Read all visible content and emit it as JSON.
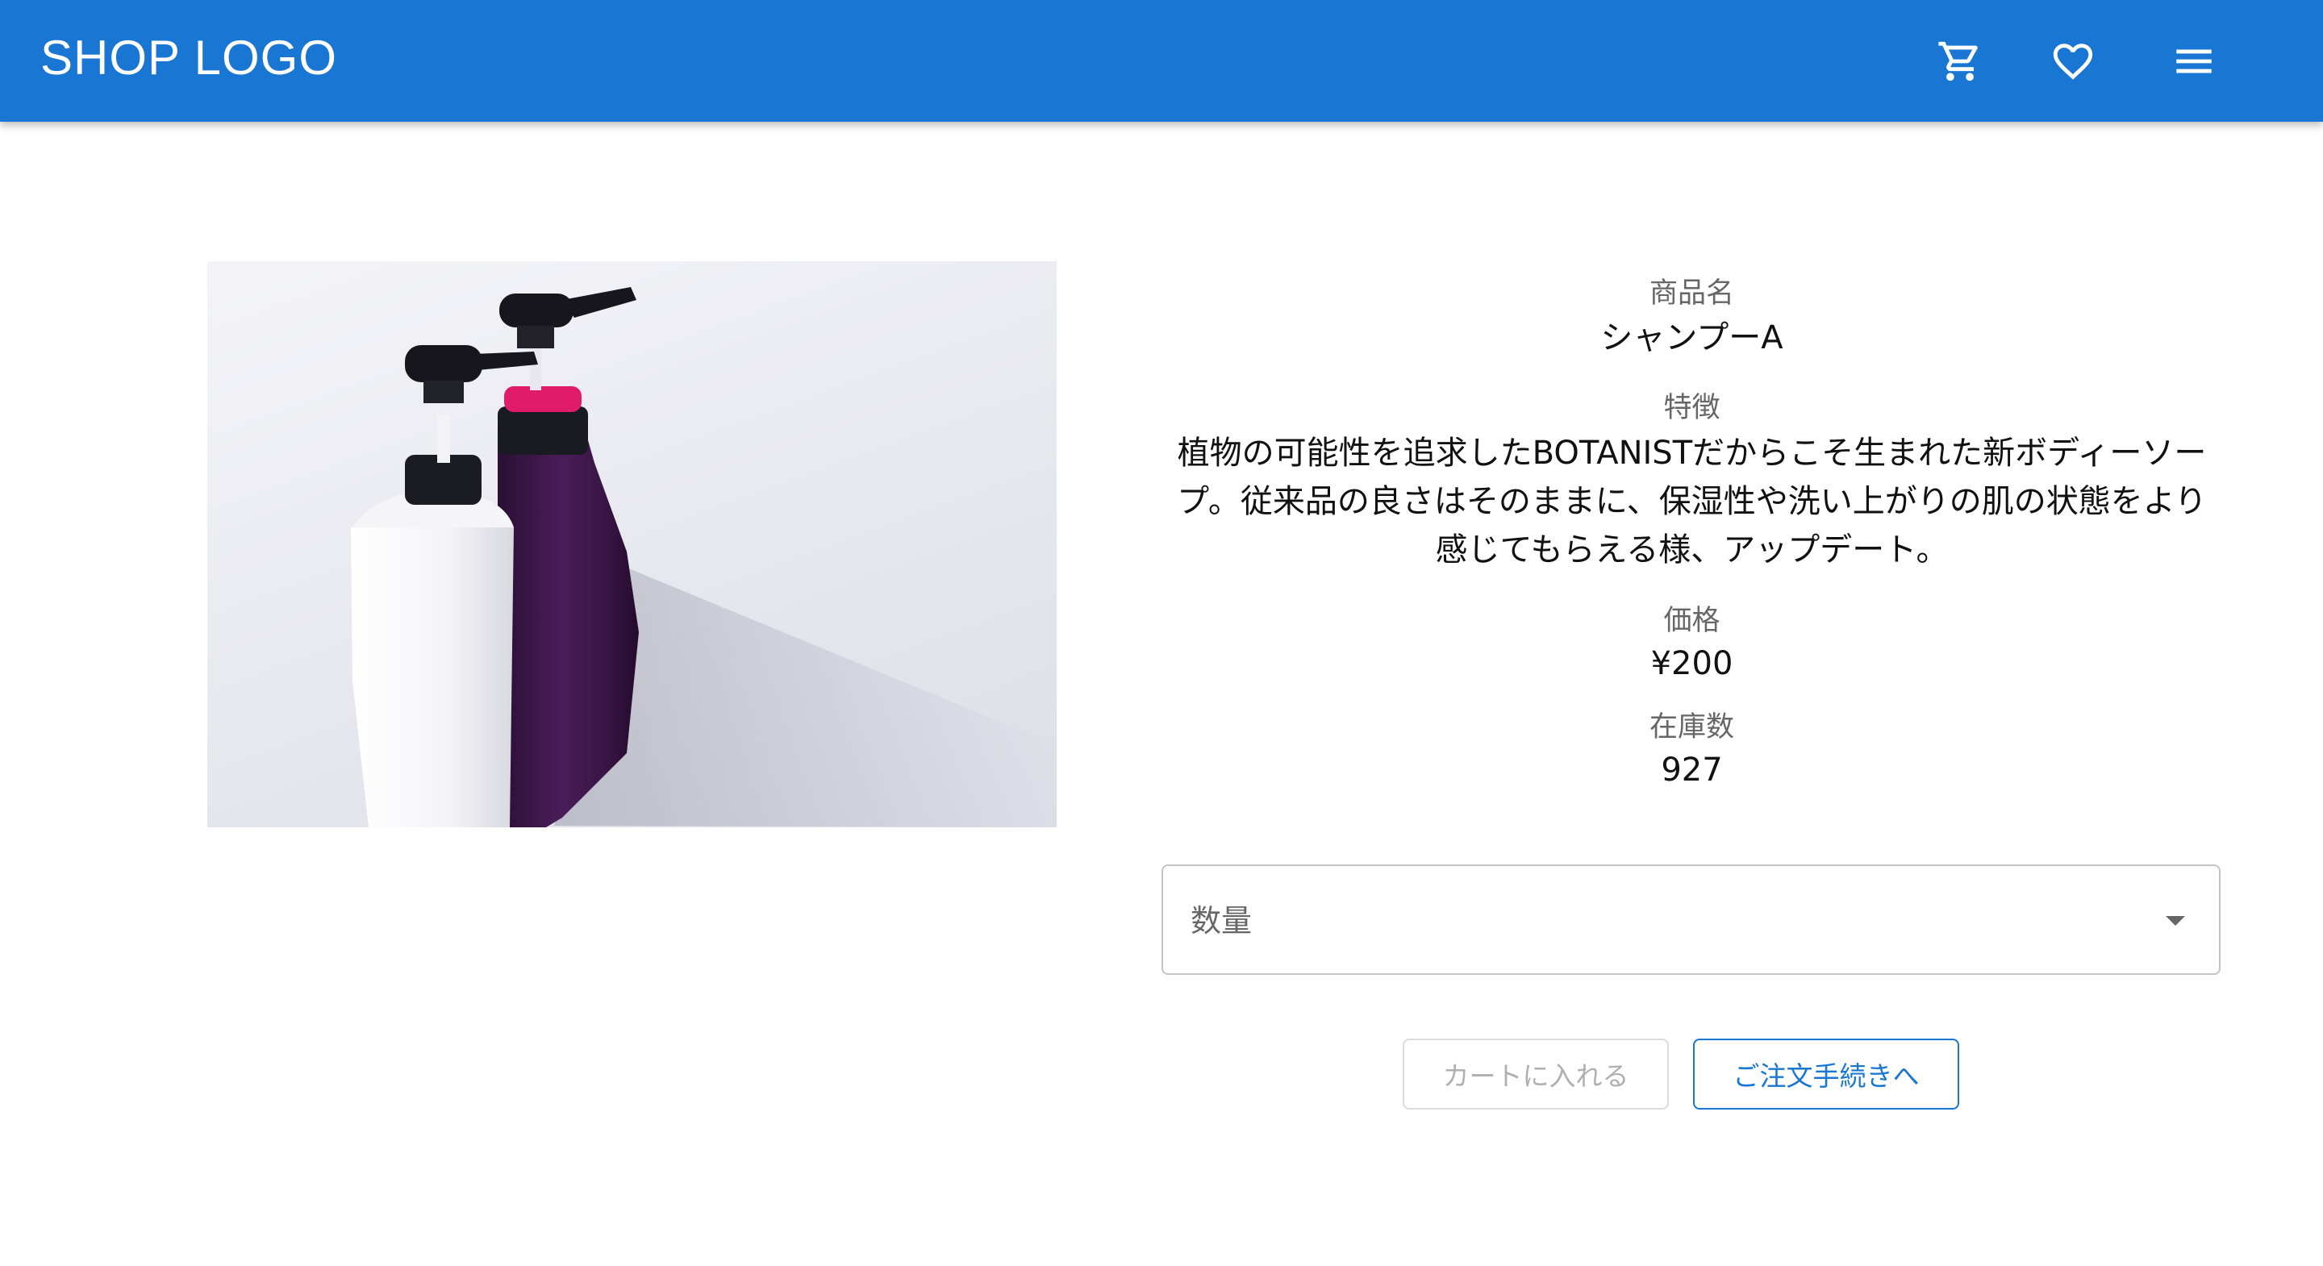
{
  "header": {
    "logo": "SHOP LOGO",
    "icons": [
      "cart-icon",
      "heart-icon",
      "menu-icon"
    ],
    "background_color": "#1976d2"
  },
  "product": {
    "name_label": "商品名",
    "name": "シャンプーA",
    "feature_label": "特徴",
    "feature": "植物の可能性を追求したBOTANISTだからこそ生まれた新ボディーソープ。従来品の良さはそのままに、保湿性や洗い上がりの肌の状態をより感じてもらえる様、アップデート。",
    "price_label": "価格",
    "price": "¥200",
    "stock_label": "在庫数",
    "stock": "927"
  },
  "quantity_select": {
    "label": "数量",
    "selected": ""
  },
  "actions": {
    "add_to_cart": "カートに入れる",
    "add_to_cart_disabled": true,
    "checkout": "ご注文手続きへ",
    "accent_color": "#1976d2"
  }
}
